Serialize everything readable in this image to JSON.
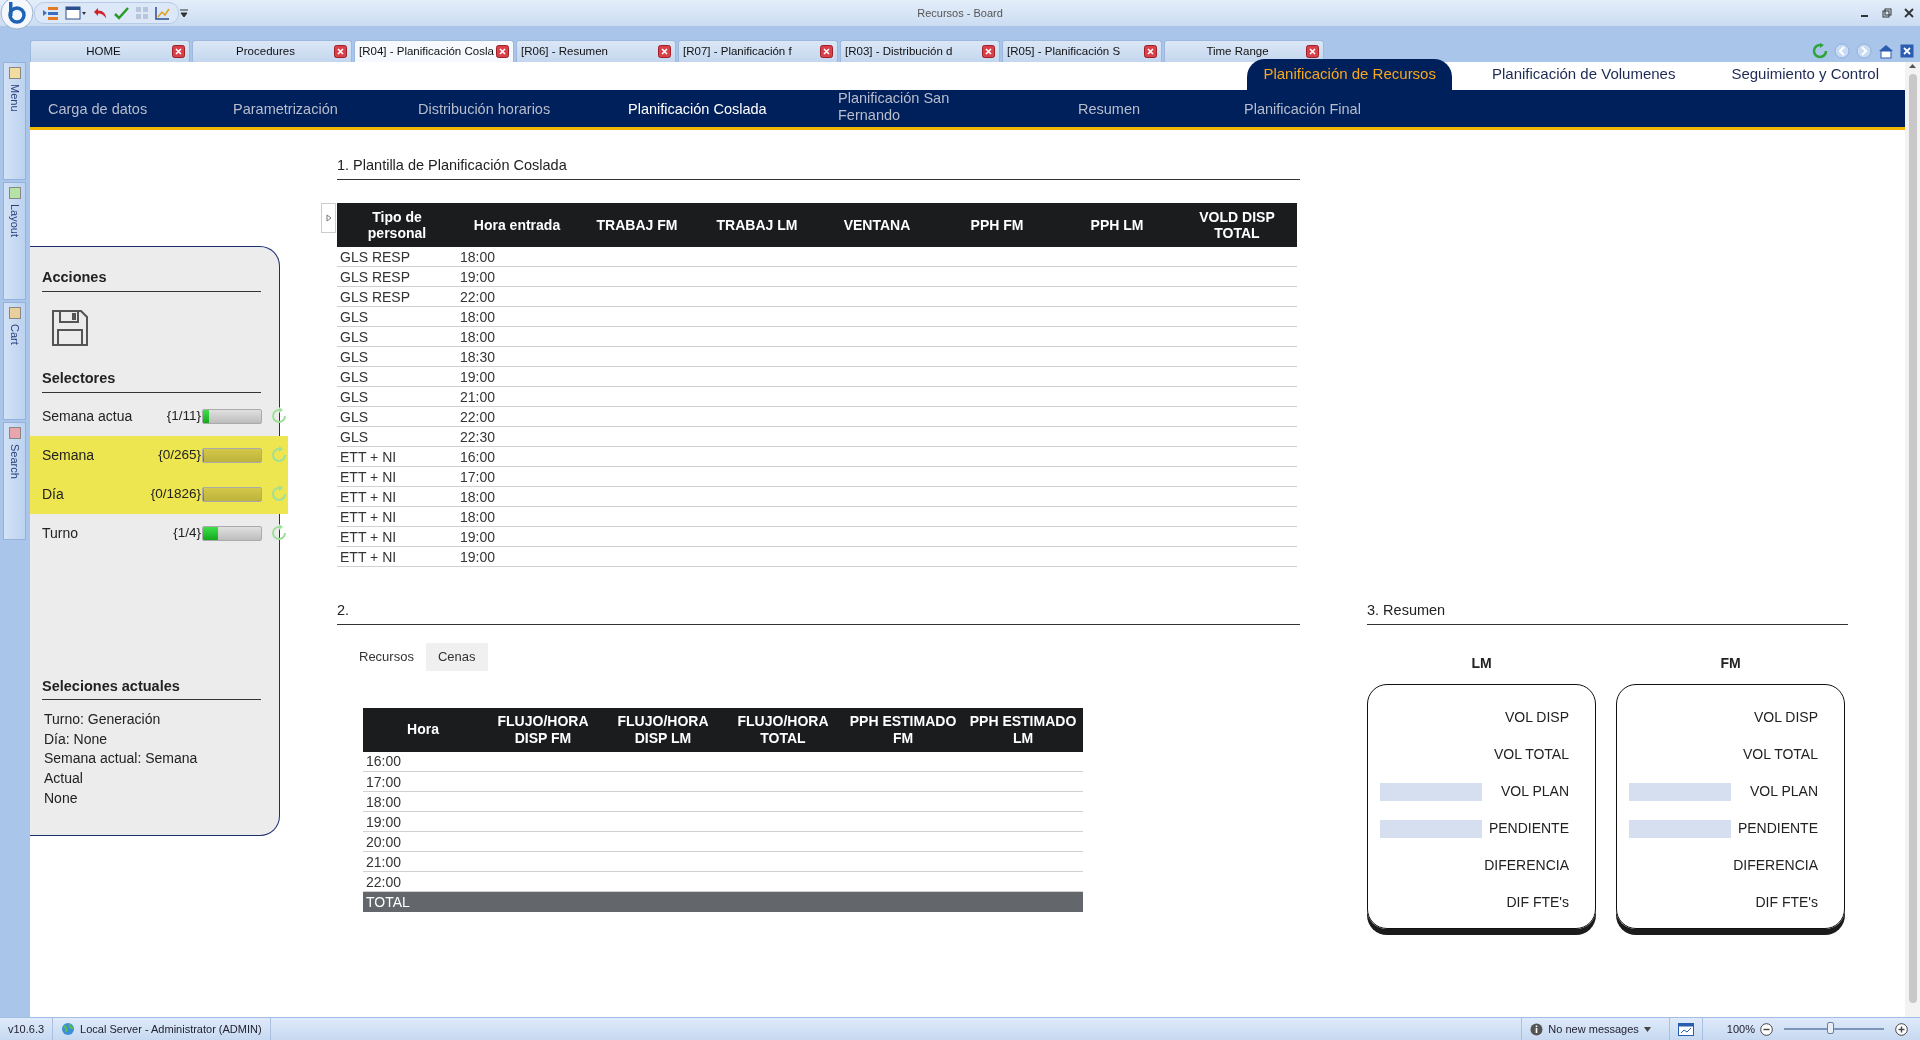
{
  "window": {
    "title": "Recursos - Board"
  },
  "doc_tabs": [
    {
      "label": "HOME",
      "selected": false
    },
    {
      "label": "Procedures",
      "selected": false
    },
    {
      "label": "[R04] - Planificación Cosla",
      "selected": true
    },
    {
      "label": "[R06] - Resumen",
      "selected": false
    },
    {
      "label": "[R07] - Planificación f",
      "selected": false
    },
    {
      "label": "[R03] - Distribución d",
      "selected": false
    },
    {
      "label": "[R05] - Planificación S",
      "selected": false
    },
    {
      "label": "Time Range",
      "selected": false
    }
  ],
  "side_dock": [
    {
      "label": "Menu",
      "color": "#f3dca0"
    },
    {
      "label": "Layout",
      "color": "#b5e3a5"
    },
    {
      "label": "Cart",
      "color": "#e8cf9c"
    },
    {
      "label": "Search",
      "color": "#e8a5ac"
    }
  ],
  "top_tabs": [
    {
      "label": "Planificación de Recursos",
      "selected": true
    },
    {
      "label": "Planificación de Volumenes",
      "selected": false
    },
    {
      "label": "Seguimiento y Control",
      "selected": false
    }
  ],
  "nav": [
    {
      "label": "Carga de datos",
      "selected": false
    },
    {
      "label": "Parametrización",
      "selected": false
    },
    {
      "label": "Distribución horarios",
      "selected": false
    },
    {
      "label": "Planificación Coslada",
      "selected": true
    },
    {
      "label": "Planificación San Fernando",
      "selected": false
    },
    {
      "label": "Resumen",
      "selected": false
    },
    {
      "label": "Planificación Final",
      "selected": false
    }
  ],
  "panel": {
    "actions_title": "Acciones",
    "selectors_title": "Selectores",
    "selectors": [
      {
        "label": "Semana actua",
        "count": "{1/11}",
        "level": 0.1,
        "highlighted": false
      },
      {
        "label": "Semana",
        "count": "{0/265}",
        "level": 0,
        "highlighted": true
      },
      {
        "label": "Día",
        "count": "{0/1826}",
        "level": 0,
        "highlighted": true
      },
      {
        "label": "Turno",
        "count": "{1/4}",
        "level": 0.25,
        "highlighted": false
      }
    ],
    "current_title": "Seleciones actuales",
    "current_lines": [
      "Turno: Generación",
      "Día: None",
      "Semana actual: Semana Actual",
      "None"
    ]
  },
  "section1": {
    "title": "1. Plantilla de Planificación Coslada",
    "columns": [
      "Tipo de personal",
      "Hora entrada",
      "TRABAJ FM",
      "TRABAJ LM",
      "VENTANA",
      "PPH FM",
      "PPH LM",
      "VOLD DISP TOTAL"
    ],
    "rows": [
      [
        "GLS RESP",
        "18:00"
      ],
      [
        "GLS RESP",
        "19:00"
      ],
      [
        "GLS RESP",
        "22:00"
      ],
      [
        "GLS",
        "18:00"
      ],
      [
        "GLS",
        "18:00"
      ],
      [
        "GLS",
        "18:30"
      ],
      [
        "GLS",
        "19:00"
      ],
      [
        "GLS",
        "21:00"
      ],
      [
        "GLS",
        "22:00"
      ],
      [
        "GLS",
        "22:30"
      ],
      [
        "ETT + NI",
        "16:00"
      ],
      [
        "ETT + NI",
        "17:00"
      ],
      [
        "ETT + NI",
        "18:00"
      ],
      [
        "ETT + NI",
        "18:00"
      ],
      [
        "ETT + NI",
        "19:00"
      ],
      [
        "ETT + NI",
        "19:00"
      ]
    ]
  },
  "section2": {
    "title": "2.",
    "tabs": [
      {
        "label": "Recursos",
        "selected": true
      },
      {
        "label": "Cenas",
        "selected": false
      }
    ],
    "columns": [
      "Hora",
      "FLUJO/HORA DISP FM",
      "FLUJO/HORA DISP LM",
      "FLUJO/HORA TOTAL",
      "PPH ESTIMADO FM",
      "PPH ESTIMADO LM"
    ],
    "rows": [
      [
        "16:00"
      ],
      [
        "17:00"
      ],
      [
        "18:00"
      ],
      [
        "19:00"
      ],
      [
        "20:00"
      ],
      [
        "21:00"
      ],
      [
        "22:00"
      ]
    ],
    "total": "TOTAL"
  },
  "section3": {
    "title": "3. Resumen",
    "cards": [
      {
        "title": "LM",
        "rows": [
          {
            "label": "VOL DISP",
            "kind": "plain"
          },
          {
            "label": "VOL TOTAL",
            "kind": "plain"
          },
          {
            "label": "VOL PLAN",
            "kind": "field"
          },
          {
            "label": "PENDIENTE",
            "kind": "field"
          },
          {
            "label": "DIFERENCIA",
            "kind": "plain"
          },
          {
            "label": "DIF FTE's",
            "kind": "plain"
          }
        ]
      },
      {
        "title": "FM",
        "rows": [
          {
            "label": "VOL DISP",
            "kind": "plain"
          },
          {
            "label": "VOL TOTAL",
            "kind": "plain"
          },
          {
            "label": "VOL PLAN",
            "kind": "field"
          },
          {
            "label": "PENDIENTE",
            "kind": "field"
          },
          {
            "label": "DIFERENCIA",
            "kind": "plain"
          },
          {
            "label": "DIF FTE's",
            "kind": "plain"
          }
        ]
      }
    ]
  },
  "status_bar": {
    "version": "v10.6.3",
    "server": "Local Server - Administrator (ADMIN)",
    "messages": "No new messages",
    "zoom": "100%",
    "zoom_slider": {
      "level": 0.47
    }
  }
}
